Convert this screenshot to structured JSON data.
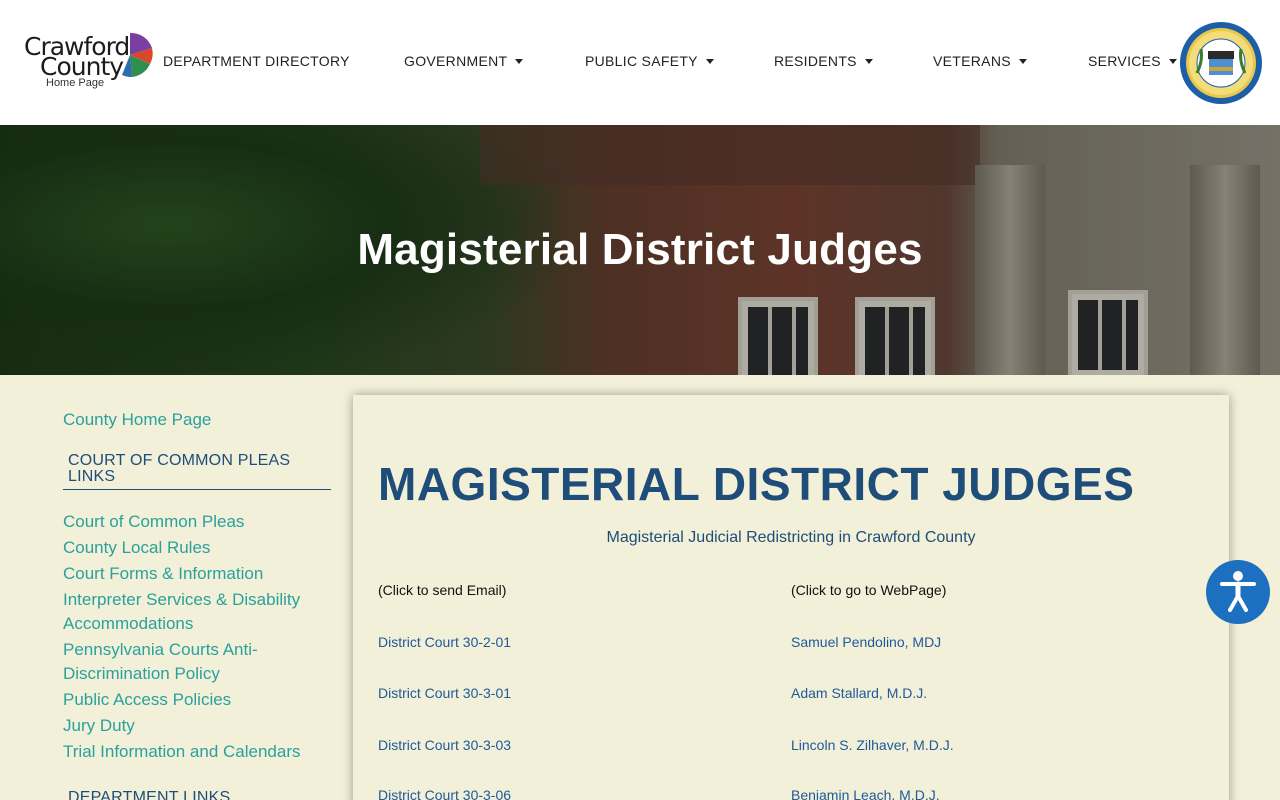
{
  "logo": {
    "line1": "Crawford",
    "line2": "County",
    "line3": "Home Page"
  },
  "nav": [
    {
      "label": "DEPARTMENT DIRECTORY",
      "dropdown": false
    },
    {
      "label": "GOVERNMENT",
      "dropdown": true
    },
    {
      "label": "PUBLIC SAFETY",
      "dropdown": true
    },
    {
      "label": "RESIDENTS",
      "dropdown": true
    },
    {
      "label": "VETERANS",
      "dropdown": true
    },
    {
      "label": "SERVICES",
      "dropdown": true
    }
  ],
  "hero": {
    "title": "Magisterial District Judges"
  },
  "sidebar": {
    "home_link": "County Home Page",
    "section1_heading": "COURT OF COMMON PLEAS LINKS",
    "links": [
      "Court of Common Pleas",
      "County Local Rules",
      "Court Forms & Information",
      "Interpreter Services & Disability Accommodations",
      "Pennsylvania Courts Anti-Discrimination Policy",
      "Public Access Policies",
      "Jury Duty",
      "Trial Information and Calendars"
    ],
    "section2_heading": "DEPARTMENT LINKS"
  },
  "main": {
    "heading": "MAGISTERIAL DISTRICT JUDGES",
    "redistricting_link": "Magisterial Judicial Redistricting in Crawford County",
    "col_email_label": "(Click to send Email)",
    "col_web_label": "(Click to go to WebPage)",
    "rows": [
      {
        "court": "District Court 30-2-01",
        "judge": "Samuel Pendolino, MDJ"
      },
      {
        "court": "District Court 30-3-01",
        "judge": "Adam Stallard, M.D.J."
      },
      {
        "court": "District Court 30-3-03",
        "judge": "Lincoln S. Zilhaver, M.D.J."
      },
      {
        "court": "District Court 30-3-06",
        "judge": "Benjamin Leach, M.D.J."
      }
    ]
  },
  "colors": {
    "accent_blue": "#1f4d7a",
    "link_teal": "#2aa19c",
    "page_bg": "#f2f0d8",
    "a11y_blue": "#1d6fbf"
  }
}
